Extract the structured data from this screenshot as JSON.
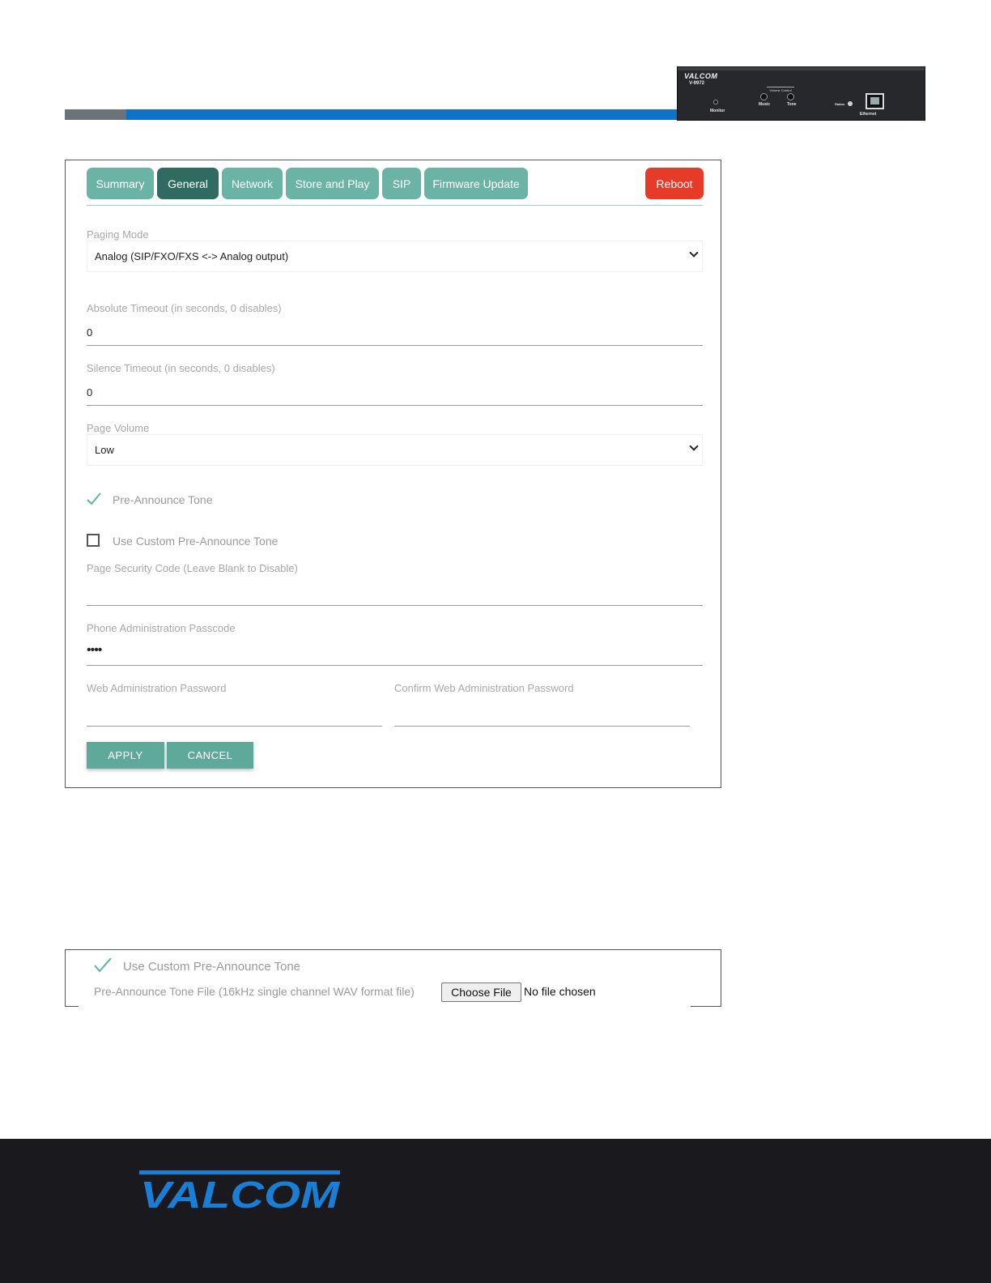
{
  "device": {
    "brand": "VALCOM",
    "model": "V-9972",
    "volume_control_label": "Volume Control",
    "labels": {
      "monitor": "Monitor",
      "music": "Music",
      "tone": "Tone",
      "status": "Status",
      "ethernet": "Ethernet"
    }
  },
  "tabs": [
    {
      "label": "Summary",
      "active": false
    },
    {
      "label": "General",
      "active": true
    },
    {
      "label": "Network",
      "active": false
    },
    {
      "label": "Store and Play",
      "active": false
    },
    {
      "label": "SIP",
      "active": false
    },
    {
      "label": "Firmware Update",
      "active": false
    }
  ],
  "reboot_label": "Reboot",
  "form": {
    "paging_mode": {
      "label": "Paging Mode",
      "value": "Analog (SIP/FXO/FXS <-> Analog output)"
    },
    "absolute_timeout": {
      "label": "Absolute Timeout (in seconds, 0 disables)",
      "value": "0"
    },
    "silence_timeout": {
      "label": "Silence Timeout (in seconds, 0 disables)",
      "value": "0"
    },
    "page_volume": {
      "label": "Page Volume",
      "value": "Low"
    },
    "pre_announce_tone": {
      "label": "Pre-Announce Tone",
      "checked": true
    },
    "custom_pre_announce_tone": {
      "label": "Use Custom Pre-Announce Tone",
      "checked": false
    },
    "page_security_code": {
      "label": "Page Security Code (Leave Blank to Disable)",
      "value": ""
    },
    "phone_admin_passcode": {
      "label": "Phone Administration Passcode",
      "value": "••••"
    },
    "web_admin_password": {
      "label": "Web Administration Password",
      "value": ""
    },
    "confirm_web_admin_password": {
      "label": "Confirm Web Administration Password",
      "value": ""
    }
  },
  "buttons": {
    "apply": "APPLY",
    "cancel": "CANCEL"
  },
  "custom_tone_panel": {
    "checkbox_label": "Use Custom Pre-Announce Tone",
    "checked": true,
    "file_label": "Pre-Announce Tone File (16kHz single channel WAV format file)",
    "choose_button": "Choose File",
    "file_status": "No file chosen"
  },
  "footer": {
    "logo_text": "VALCOM"
  },
  "colors": {
    "tab": "#6bb3a5",
    "tab_active": "#2f6b60",
    "reboot": "#e73b2a",
    "button": "#5fa99b",
    "accent_blue": "#0f72c4",
    "footer_bg": "#1a191e"
  }
}
